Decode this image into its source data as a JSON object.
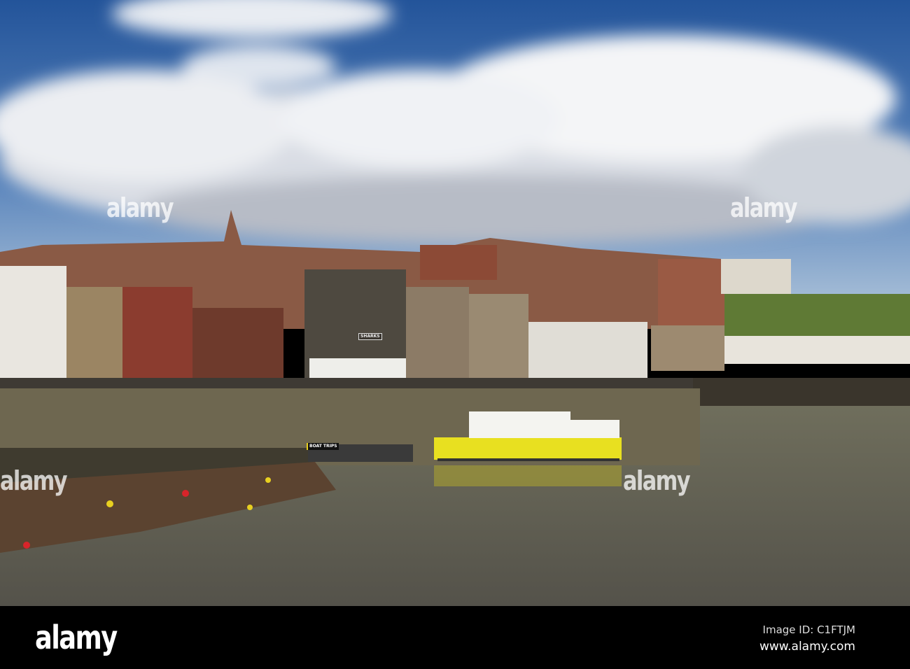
{
  "photo": {
    "subject": "harbour town waterfront",
    "watermark_text": "alamy",
    "boat_sign": "BOAT TRIPS",
    "building_sign": "SHARKS"
  },
  "footer": {
    "logo": "alamy",
    "image_id": "Image ID: C1FTJM",
    "url": "www.alamy.com"
  },
  "colors": {
    "sky": "#2f5f9f",
    "water": "#5a5a48",
    "boat": "#e8e020",
    "bar": "#000000"
  }
}
